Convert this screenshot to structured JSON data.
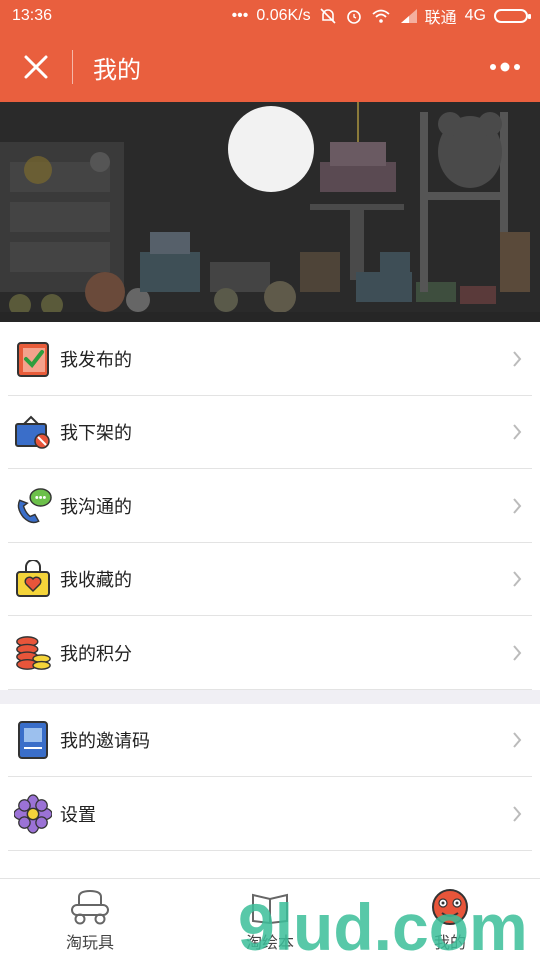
{
  "status": {
    "time": "13:36",
    "speed": "0.06K/s",
    "carrier": "联通",
    "network": "4G"
  },
  "header": {
    "title": "我的"
  },
  "menu_group_1": [
    {
      "label": "我发布的",
      "icon": "clipboard-check-icon"
    },
    {
      "label": "我下架的",
      "icon": "gift-box-remove-icon"
    },
    {
      "label": "我沟通的",
      "icon": "phone-chat-icon"
    },
    {
      "label": "我收藏的",
      "icon": "heart-bag-icon"
    },
    {
      "label": "我的积分",
      "icon": "coin-stack-icon"
    }
  ],
  "menu_group_2": [
    {
      "label": "我的邀请码",
      "icon": "book-icon"
    },
    {
      "label": "设置",
      "icon": "flower-gear-icon"
    }
  ],
  "tabbar": [
    {
      "label": "淘玩具",
      "icon": "car-toy-icon"
    },
    {
      "label": "淘绘本",
      "icon": "picture-book-icon"
    },
    {
      "label": "我的",
      "icon": "cartoon-face-icon"
    }
  ],
  "watermark": {
    "text": "9lud.com"
  },
  "colors": {
    "accent": "#e95f3e",
    "banner": "#2a2a2a"
  }
}
